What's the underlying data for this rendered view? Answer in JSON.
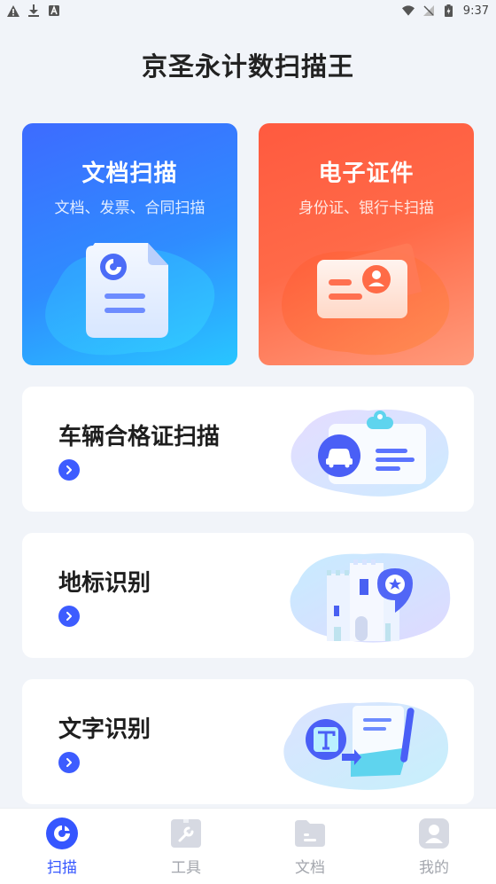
{
  "status_bar": {
    "time": "9:37"
  },
  "app_title": "京圣永计数扫描王",
  "top_cards": [
    {
      "title": "文档扫描",
      "subtitle": "文档、发票、合同扫描"
    },
    {
      "title": "电子证件",
      "subtitle": "身份证、银行卡扫描"
    }
  ],
  "features": [
    {
      "title": "车辆合格证扫描"
    },
    {
      "title": "地标识别"
    },
    {
      "title": "文字识别"
    }
  ],
  "nav": [
    {
      "label": "扫描",
      "active": true
    },
    {
      "label": "工具"
    },
    {
      "label": "文档"
    },
    {
      "label": "我的"
    }
  ],
  "colors": {
    "accent": "#3556ff",
    "doc_card": "#3d6bff",
    "id_card": "#ff5a3f"
  }
}
